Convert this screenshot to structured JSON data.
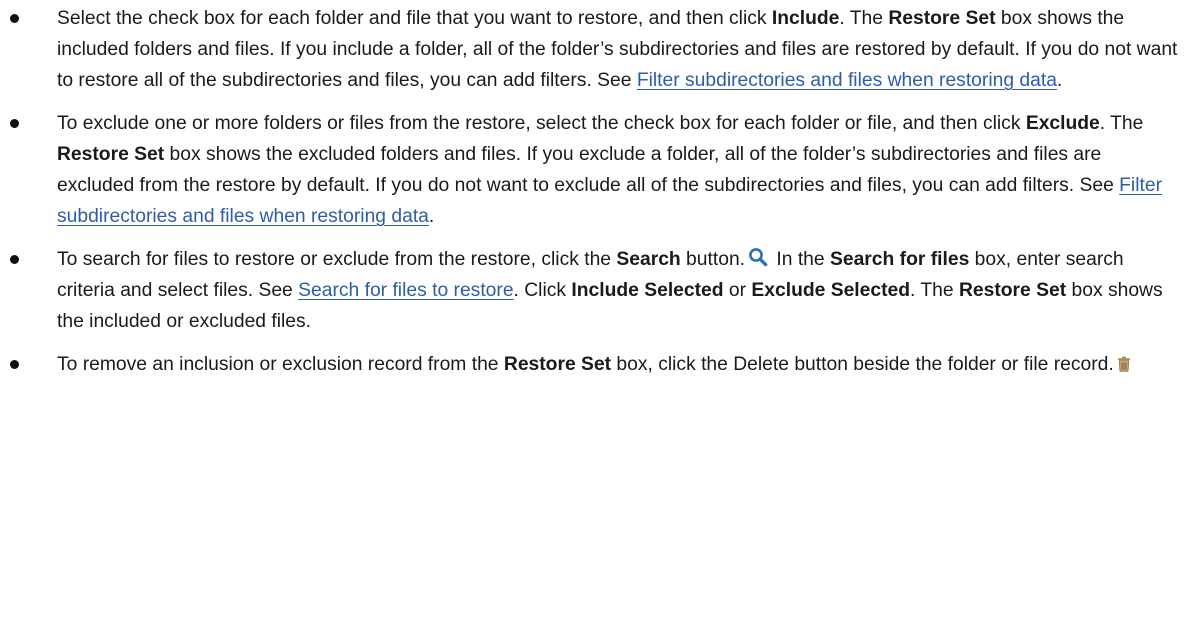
{
  "bullets": [
    {
      "t1": "Select the check box for each folder and file that you want to restore, and then click ",
      "b1": "Include",
      "t2": ". The ",
      "b2": "Restore Set",
      "t3": " box shows the included folders and files. If you include a folder, all of the folder’s subdirectories and files are restored by default. If you do not want to restore all of the subdirectories and files, you can add filters. See ",
      "link": "Filter subdirectories and files when restoring data",
      "t4": "."
    },
    {
      "t1": "To exclude one or more folders or files from the restore, select the check box for each folder or file, and then click ",
      "b1": "Exclude",
      "t2": ". The ",
      "b2": "Restore Set",
      "t3": " box shows the excluded folders and files. If you exclude a folder, all of the folder’s subdirectories and files are excluded from the restore by default. If you do not want to exclude all of the subdirectories and files, you can add filters. See ",
      "link": "Filter subdirectories and files when restoring data",
      "t4": "."
    },
    {
      "t1": "To search for files to restore or exclude from the restore, click the ",
      "b1": "Search",
      "t2": " button.",
      "icon": "search-icon",
      "t3": " In the ",
      "b2": "Search for files",
      "t4": " box, enter search criteria and select files. See ",
      "link": "Search for files to restore",
      "t5": ". Click ",
      "b3": "Include Selected",
      "t6": " or ",
      "b4": "Exclude Selected",
      "t7": ". The ",
      "b5": "Restore Set",
      "t8": " box shows the included or excluded files."
    },
    {
      "t1": "To remove an inclusion or exclusion record from the ",
      "b1": "Restore Set",
      "t2": " box, click the Delete button beside the folder or file record.",
      "icon": "trash-icon"
    }
  ],
  "colors": {
    "link": "#2e5da8",
    "search_icon": "#2f6fb4",
    "trash_icon": "#b08a58"
  }
}
